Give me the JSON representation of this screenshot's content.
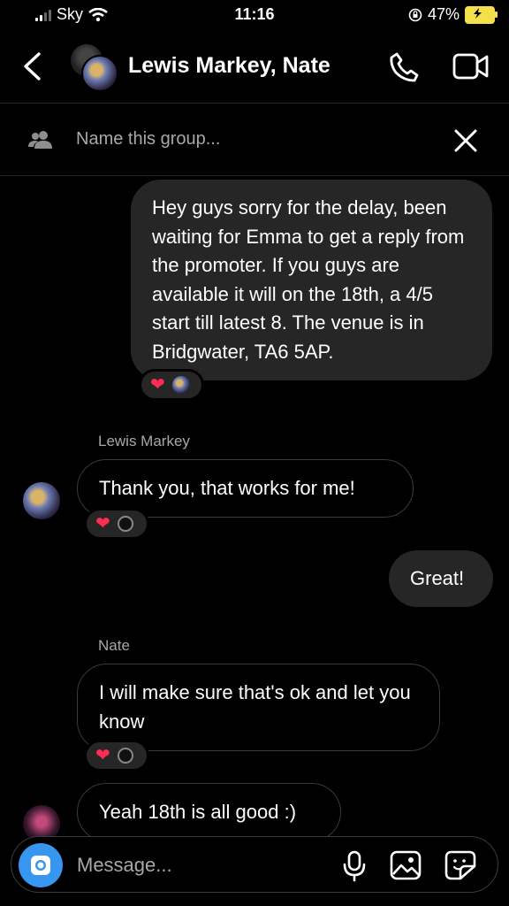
{
  "status": {
    "carrier": "Sky",
    "time": "11:16",
    "battery": "47%"
  },
  "header": {
    "title": "Lewis Markey, Nate"
  },
  "group": {
    "name_placeholder": "Name this group..."
  },
  "messages": [
    {
      "type": "out",
      "text": "Hey guys sorry for the delay, been waiting for Emma to get a reply from the promoter. If you guys are available it will on the 18th, a 4/5 start till latest 8. The venue is in Bridgwater, TA6 5AP.",
      "reactions": [
        "heart",
        "avatar"
      ]
    },
    {
      "type": "in",
      "sender": "Lewis Markey",
      "text": "Thank you, that works for me!",
      "reactions": [
        "heart",
        "avatar"
      ]
    },
    {
      "type": "out",
      "text": "Great!"
    },
    {
      "type": "in",
      "sender": "Nate",
      "text": "I will make sure that's ok and let you know",
      "reactions": [
        "heart",
        "avatar"
      ]
    },
    {
      "type": "in",
      "text": "Yeah 18th is all good :)"
    }
  ],
  "composer": {
    "placeholder": "Message..."
  },
  "icons": {
    "back": "back-chevron-icon",
    "call": "phone-icon",
    "video": "video-icon",
    "group": "group-icon",
    "close": "close-icon",
    "camera": "camera-icon",
    "mic": "microphone-icon",
    "gallery": "gallery-icon",
    "sticker": "sticker-icon"
  },
  "colors": {
    "accent": "#3797f0",
    "heart": "#ff2c55",
    "battery": "#f4e04d",
    "bubble_out": "#262626"
  }
}
